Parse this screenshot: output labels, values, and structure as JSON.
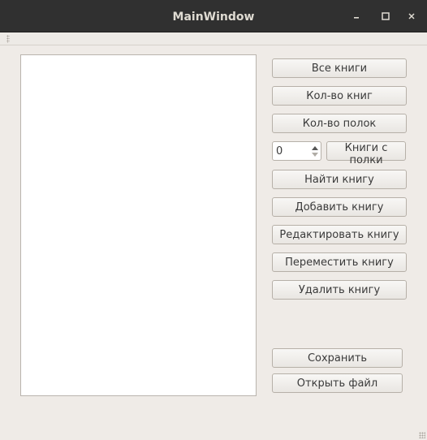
{
  "window": {
    "title": "MainWindow",
    "controls": {
      "minimize": "minimize-icon",
      "maximize": "maximize-icon",
      "close": "close-icon"
    }
  },
  "spinbox": {
    "value": "0"
  },
  "buttons": {
    "all_books": "Все книги",
    "book_count": "Кол-во книг",
    "shelf_count": "Кол-во полок",
    "books_from_shelf": "Книги с полки",
    "find_book": "Найти книгу",
    "add_book": "Добавить книгу",
    "edit_book": "Редактировать книгу",
    "move_book": "Переместить книгу",
    "delete_book": "Удалить книгу",
    "save": "Сохранить",
    "open_file": "Открыть файл"
  },
  "colors": {
    "titlebar": "#303030",
    "window_bg": "#efebe7",
    "title_text": "#dfdbd2"
  }
}
